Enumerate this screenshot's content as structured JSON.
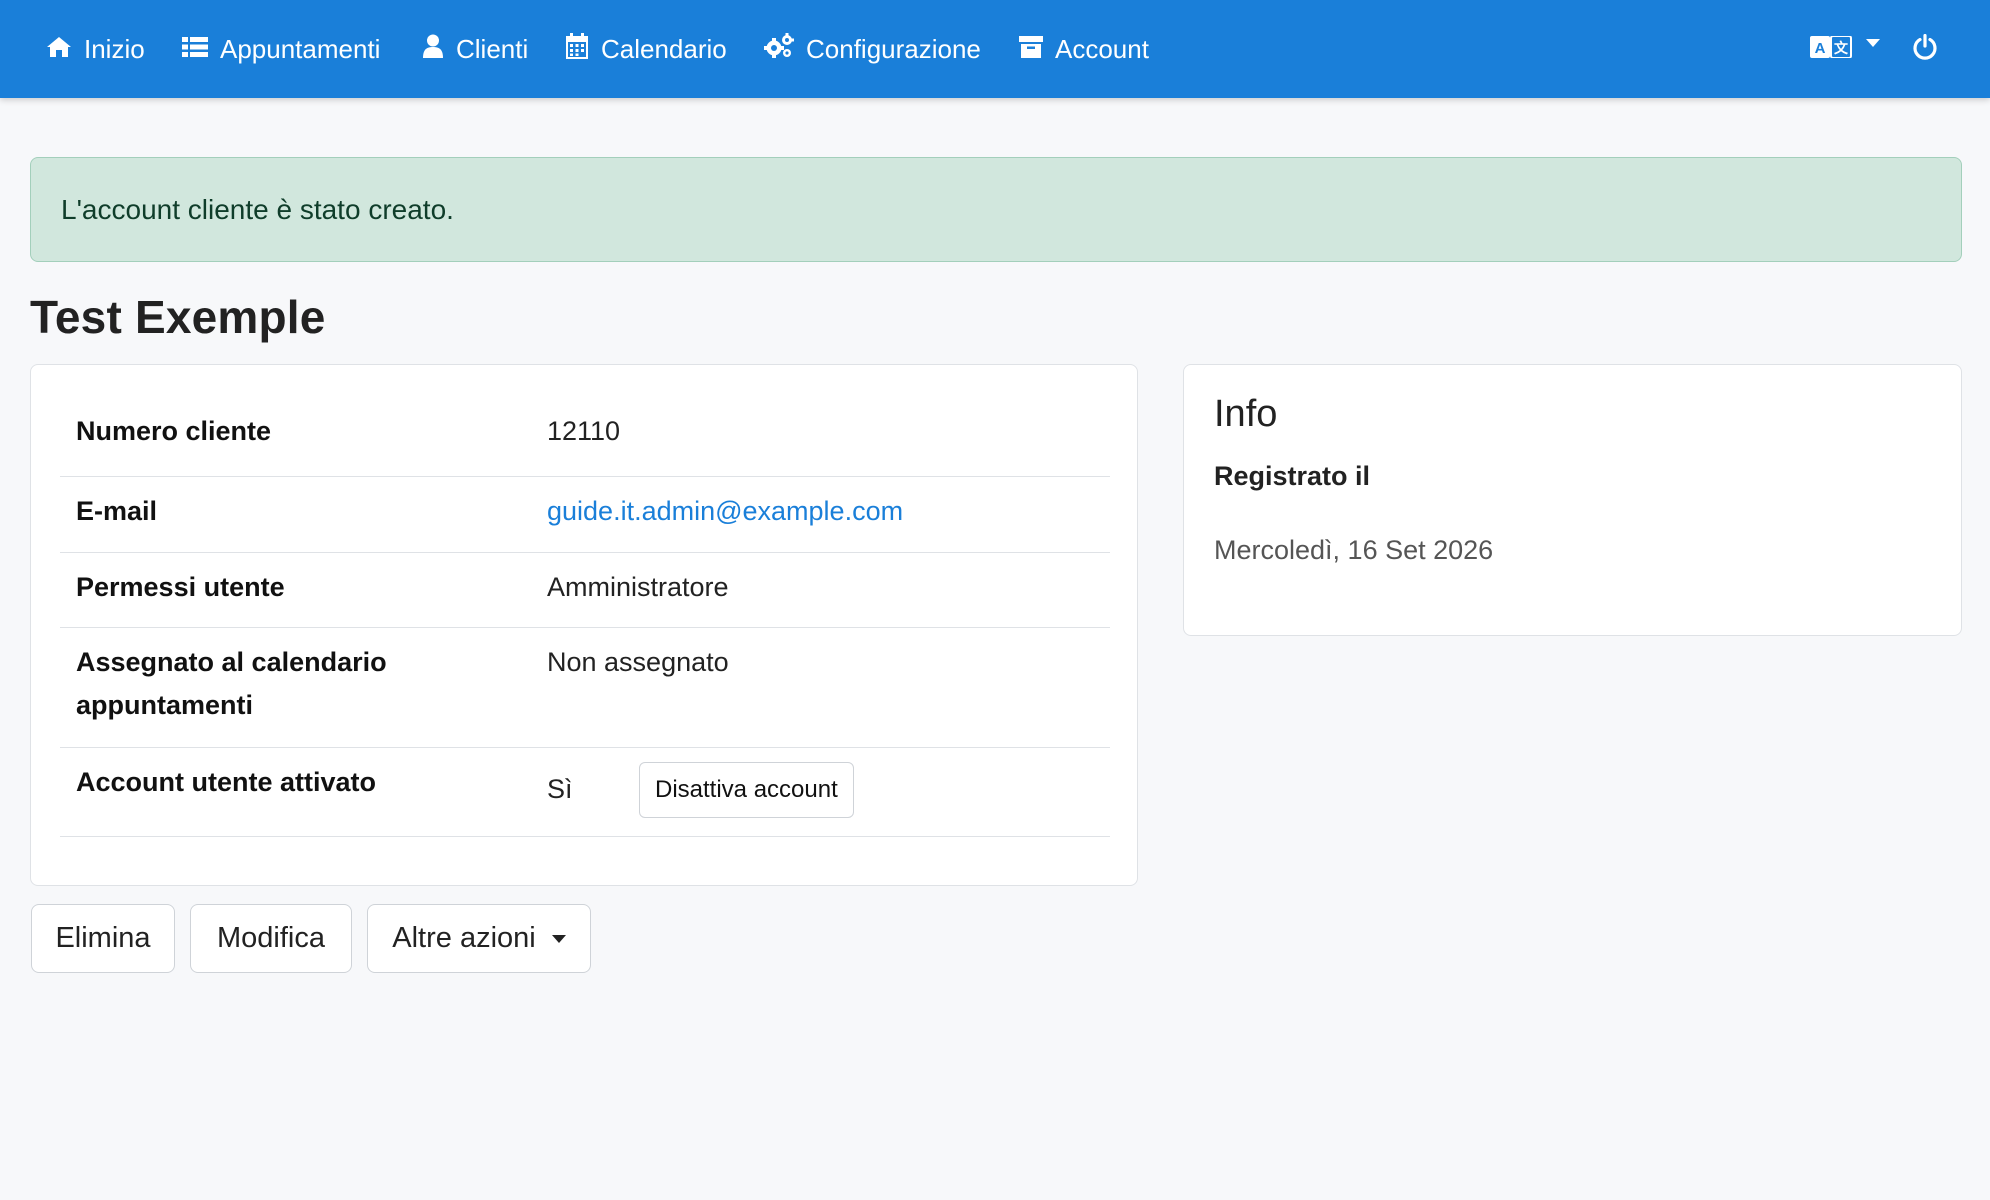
{
  "nav": {
    "items": [
      {
        "label": "Inizio",
        "icon": "home-icon"
      },
      {
        "label": "Appuntamenti",
        "icon": "list-icon"
      },
      {
        "label": "Clienti",
        "icon": "user-icon"
      },
      {
        "label": "Calendario",
        "icon": "calendar-icon"
      },
      {
        "label": "Configurazione",
        "icon": "gears-icon"
      },
      {
        "label": "Account",
        "icon": "archive-icon"
      }
    ],
    "language_icon": "language-icon",
    "logout_icon": "power-icon",
    "color": "#1a7fd9"
  },
  "alert": {
    "message": "L'account cliente è stato creato.",
    "type": "success"
  },
  "page": {
    "title": "Test Exemple"
  },
  "details": {
    "rows": [
      {
        "label": "Numero cliente",
        "value": "12110"
      },
      {
        "label": "E-mail",
        "value": "guide.it.admin@example.com"
      },
      {
        "label": "Permessi utente",
        "value": "Amministratore"
      },
      {
        "label": "Assegnato al calendario appuntamenti",
        "value": "Non assegnato"
      },
      {
        "label": "Account utente attivato",
        "value": "Sì"
      }
    ],
    "deactivate_button": "Disattiva account"
  },
  "info": {
    "title": "Info",
    "registered_label": "Registrato il",
    "registered_date": "Mercoledì, 16 Set 2026"
  },
  "actions": {
    "delete": "Elimina",
    "edit": "Modifica",
    "more": "Altre azioni"
  }
}
